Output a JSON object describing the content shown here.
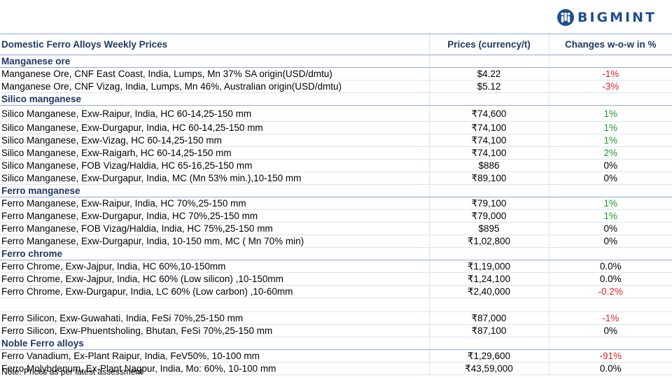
{
  "brand": {
    "name": "BIGMINT",
    "color": "#1f4e8c"
  },
  "table": {
    "headers": [
      "Domestic Ferro Alloys Weekly Prices",
      "Prices (currency/t)",
      "Changes w-o-w in %"
    ],
    "rows": [
      {
        "type": "section",
        "label": "Manganese ore"
      },
      {
        "type": "item",
        "name": "Manganese Ore, CNF East Coast, India, Lumps, Mn 37% SA origin(USD/dmtu)",
        "price": "$4.22",
        "change": "-1%",
        "trend": "down"
      },
      {
        "type": "item",
        "name": "Manganese Ore, CNF Vizag, India, Lumps, Mn 46%, Australian origin(USD/dmtu)",
        "price": "$5.12",
        "change": "-3%",
        "trend": "down"
      },
      {
        "type": "section",
        "label": "Silico manganese"
      },
      {
        "type": "item",
        "tall": true,
        "name": "Silico Manganese, Exw-Raipur, India, HC 60-14,25-150 mm",
        "price": "₹74,600",
        "change": "1%",
        "trend": "up"
      },
      {
        "type": "item",
        "name": "Silico Manganese, Exw-Durgapur, India, HC 60-14,25-150 mm",
        "price": "₹74,100",
        "change": "1%",
        "trend": "up"
      },
      {
        "type": "item",
        "name": "Silico Manganese, Exw-Vizag, HC 60-14,25-150 mm",
        "price": "₹74,100",
        "change": "1%",
        "trend": "up"
      },
      {
        "type": "item",
        "name": "Silico Manganese, Exw-Raigarh, HC 60-14,25-150 mm",
        "price": "₹74,100",
        "change": "2%",
        "trend": "up"
      },
      {
        "type": "item",
        "name": "Silico Manganese, FOB Vizag/Haldia, HC 65-16,25-150 mm",
        "price": "$886",
        "change": "0%",
        "trend": "flat"
      },
      {
        "type": "item",
        "name": "Silico Manganese, Exw-Durgapur, India, MC (Mn 53% min.),10-150 mm",
        "price": "₹89,100",
        "change": "0%",
        "trend": "flat"
      },
      {
        "type": "section",
        "label": "Ferro manganese"
      },
      {
        "type": "item",
        "name": "Ferro Manganese, Exw-Raipur, India, HC 70%,25-150 mm",
        "price": "₹79,100",
        "change": "1%",
        "trend": "up"
      },
      {
        "type": "item",
        "name": "Ferro Manganese, Exw-Durgapur, India, HC 70%,25-150 mm",
        "price": "₹79,000",
        "change": "1%",
        "trend": "up"
      },
      {
        "type": "item",
        "name": "Ferro Manganese, FOB Vizag/Haldia, India, HC 75%,25-150 mm",
        "price": "$895",
        "change": "0%",
        "trend": "flat"
      },
      {
        "type": "item",
        "name": "Ferro Manganese, Exw-Durgapur, India, 10-150 mm, MC ( Mn 70% min)",
        "price": "₹1,02,800",
        "change": "0%",
        "trend": "flat"
      },
      {
        "type": "section",
        "label": "Ferro chrome"
      },
      {
        "type": "item",
        "name": "Ferro Chrome, Exw-Jajpur, India, HC 60%,10-150mm",
        "price": "₹1,19,000",
        "change": "0.0%",
        "trend": "flat"
      },
      {
        "type": "item",
        "name": "Ferro Chrome, Exw-Jajpur, India, HC 60% (Low silicon) ,10-150mm",
        "price": "₹1,24,100",
        "change": "0.0%",
        "trend": "flat"
      },
      {
        "type": "item",
        "name": "Ferro Chrome, Exw-Durgapur, India, LC 60% (Low carbon) ,10-60mm",
        "price": "₹2,40,000",
        "change": "-0.2%",
        "trend": "down"
      },
      {
        "type": "blank"
      },
      {
        "type": "item",
        "name": "Ferro Silicon, Exw-Guwahati, India, FeSi 70%,25-150 mm",
        "price": "₹87,000",
        "change": "-1%",
        "trend": "down"
      },
      {
        "type": "item",
        "name": "Ferro Silicon, Exw-Phuentsholing, Bhutan, FeSi 70%,25-150 mm",
        "price": "₹87,100",
        "change": "0%",
        "trend": "flat"
      },
      {
        "type": "section",
        "label": "Noble Ferro alloys"
      },
      {
        "type": "item",
        "name": "Ferro Vanadium, Ex-Plant Raipur, India, FeV50%,  10-100 mm",
        "price": "₹1,29,600",
        "change": "-91%",
        "trend": "down"
      },
      {
        "type": "item",
        "name": "Ferro Molybdenum, Ex-Plant Nagpur, India, Mo: 60%, 10-100 mm",
        "price": "₹43,59,000",
        "change": "0.0%",
        "trend": "flat"
      }
    ]
  },
  "note": "Note: Prices as per latest assessment",
  "colors": {
    "up": "#1a9a2a",
    "down": "#e02020",
    "header": "#1f3864"
  }
}
